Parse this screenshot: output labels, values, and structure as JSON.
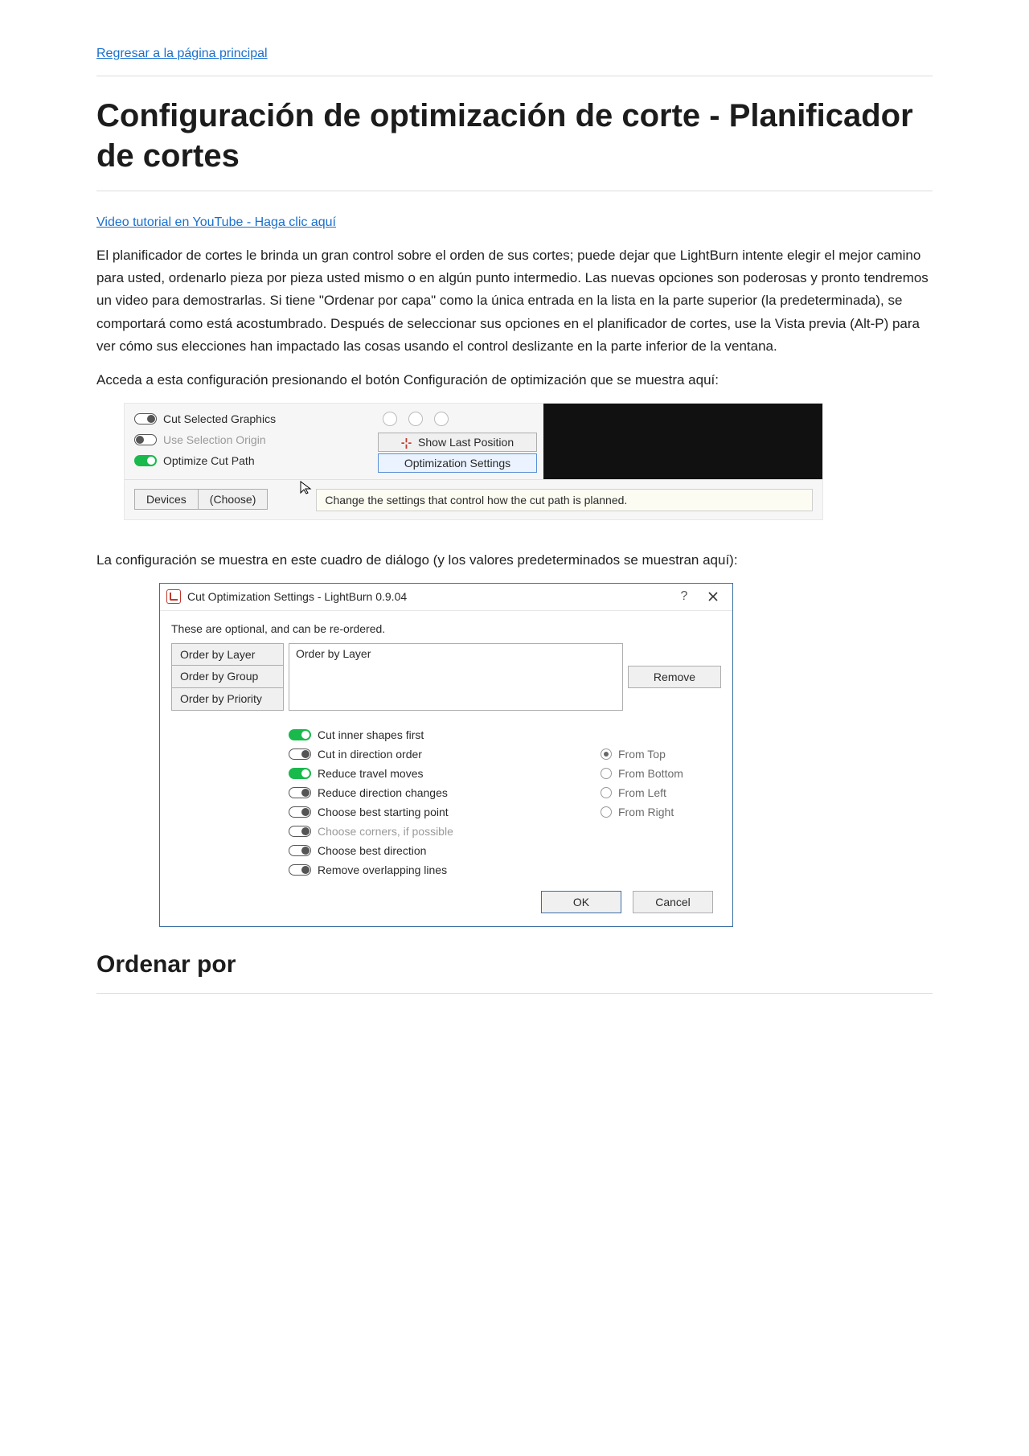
{
  "nav": {
    "back_link": "Regresar a la página principal"
  },
  "page": {
    "title": "Configuración de optimización de corte - Planificador de cortes",
    "video_link": "Video tutorial en YouTube - Haga clic aquí",
    "intro": "El planificador de cortes le brinda un gran control sobre el orden de sus cortes; puede dejar que LightBurn intente elegir el mejor camino para usted, ordenarlo pieza por pieza usted mismo o en algún punto intermedio. Las nuevas opciones son poderosas y pronto tendremos un video para demostrarlas. Si tiene \"Ordenar por capa\" como la única entrada en la lista en la parte superior (la predeterminada), se comportará como está acostumbrado. Después de seleccionar sus opciones en el planificador de cortes, use la Vista previa (Alt-P) para ver cómo sus elecciones han impactado las cosas usando el control deslizante en la parte inferior de la ventana.",
    "access_hint": "Acceda a esta configuración presionando el botón Configuración de optimización que se muestra aquí:",
    "dialog_hint": "La configuración se muestra en este cuadro de diálogo (y los valores predeterminados se muestran aquí):",
    "section_order": "Ordenar por"
  },
  "panel": {
    "cut_selected": "Cut Selected Graphics",
    "use_selection_origin": "Use Selection Origin",
    "optimize_cut_path": "Optimize Cut Path",
    "show_last_position": "Show Last Position",
    "optimization_settings": "Optimization Settings",
    "devices": "Devices",
    "choose": "(Choose)",
    "tooltip": "Change the settings that control how the cut path is planned."
  },
  "dialog": {
    "title": "Cut Optimization Settings - LightBurn 0.9.04",
    "hint": "These are optional, and can be re-ordered.",
    "order_buttons": [
      "Order by Layer",
      "Order by Group",
      "Order by Priority"
    ],
    "order_list_item": "Order by Layer",
    "remove": "Remove",
    "options": [
      {
        "label": "Cut inner shapes first",
        "on": true
      },
      {
        "label": "Cut in direction order",
        "on": false
      },
      {
        "label": "Reduce travel moves",
        "on": true
      },
      {
        "label": "Reduce direction changes",
        "on": false
      },
      {
        "label": "Choose best starting point",
        "on": false
      },
      {
        "label": "Choose corners, if possible",
        "on": false,
        "disabled": true
      },
      {
        "label": "Choose best direction",
        "on": false
      },
      {
        "label": "Remove overlapping lines",
        "on": false
      }
    ],
    "radios": [
      "From Top",
      "From Bottom",
      "From Left",
      "From Right"
    ],
    "radio_selected": 0,
    "ok": "OK",
    "cancel": "Cancel"
  }
}
